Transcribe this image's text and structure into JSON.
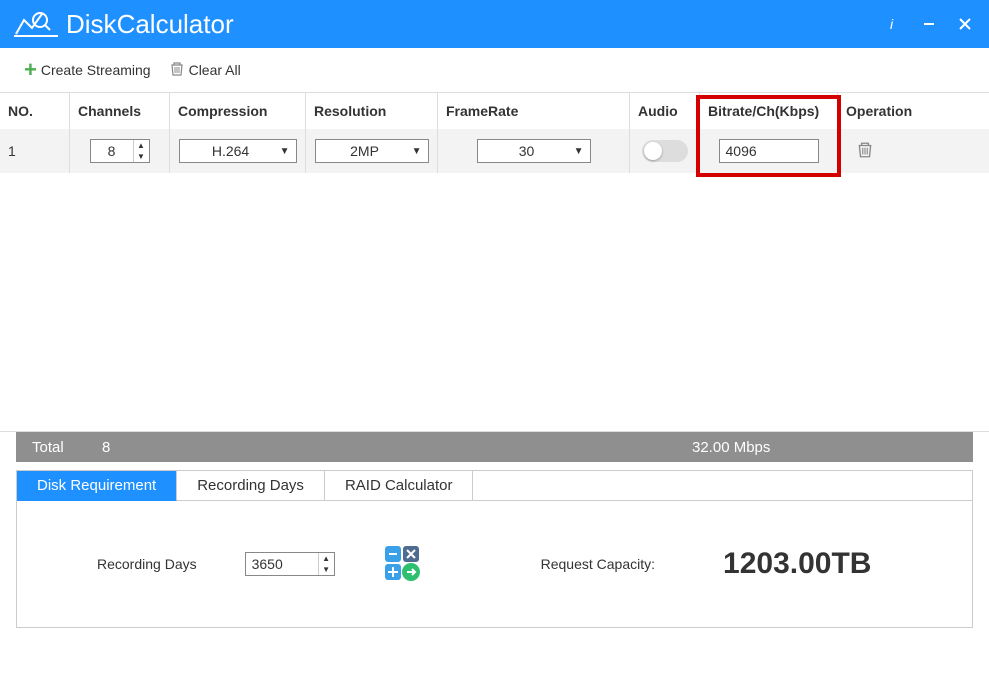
{
  "title": {
    "bold": "Disk",
    "thin": " Calculator"
  },
  "toolbar": {
    "create_streaming": "Create Streaming",
    "clear_all": "Clear All"
  },
  "columns": {
    "no": "NO.",
    "channels": "Channels",
    "compression": "Compression",
    "resolution": "Resolution",
    "framerate": "FrameRate",
    "audio": "Audio",
    "bitrate": "Bitrate/Ch(Kbps)",
    "operation": "Operation"
  },
  "row": {
    "no": "1",
    "channels": "8",
    "compression": "H.264",
    "resolution": "2MP",
    "framerate": "30",
    "bitrate": "4096"
  },
  "totals": {
    "label": "Total",
    "channels": "8",
    "mbps": "32.00 Mbps"
  },
  "tabs": {
    "disk_req": "Disk Requirement",
    "rec_days": "Recording Days",
    "raid": "RAID Calculator"
  },
  "form": {
    "recording_days_label": "Recording Days",
    "recording_days_value": "3650",
    "request_capacity_label": "Request Capacity:",
    "request_capacity_value": "1203.00TB"
  }
}
